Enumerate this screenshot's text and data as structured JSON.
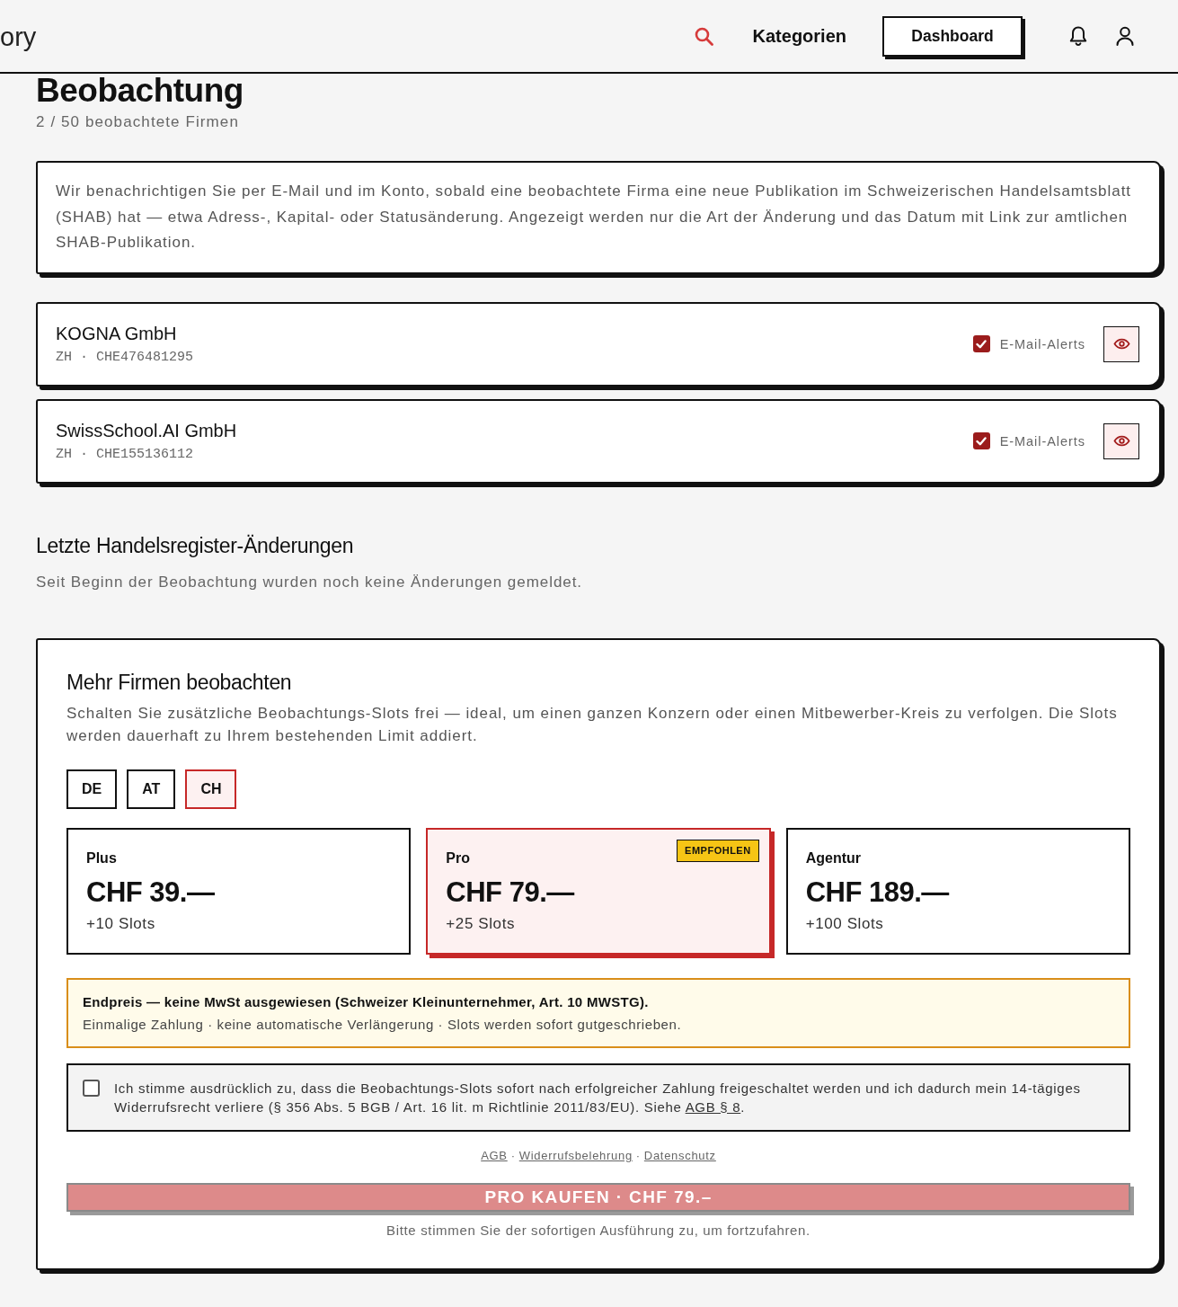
{
  "header": {
    "logo": "ory",
    "nav_link": "Kategorien",
    "dashboard_button": "Dashboard"
  },
  "page": {
    "title": "Beobachtung",
    "subtitle": "2 / 50 beobachtete Firmen"
  },
  "info": "Wir benachrichtigen Sie per E-Mail und im Konto, sobald eine beobachtete Firma eine neue Publikation im Schweizerischen Handelsamtsblatt (SHAB) hat — etwa Adress-, Kapital- oder Statusänderung. Angezeigt werden nur die Art der Änderung und das Datum mit Link zur amtlichen SHAB-Publikation.",
  "companies": [
    {
      "name": "KOGNA GmbH",
      "meta": "ZH · CHE476481295",
      "alert_label": "E-Mail-Alerts",
      "alerts": true
    },
    {
      "name": "SwissSchool.AI GmbH",
      "meta": "ZH · CHE155136112",
      "alert_label": "E-Mail-Alerts",
      "alerts": true
    }
  ],
  "changes": {
    "title": "Letzte Handelsregister-Änderungen",
    "empty_text": "Seit Beginn der Beobachtung wurden noch keine Änderungen gemeldet."
  },
  "upgrade": {
    "title": "Mehr Firmen beobachten",
    "description": "Schalten Sie zusätzliche Beobachtungs-Slots frei — ideal, um einen ganzen Konzern oder einen Mitbewerber-Kreis zu verfolgen. Die Slots werden dauerhaft zu Ihrem bestehenden Limit addiert.",
    "countries": [
      {
        "label": "DE",
        "selected": false
      },
      {
        "label": "AT",
        "selected": false
      },
      {
        "label": "CH",
        "selected": true
      }
    ],
    "plans": [
      {
        "name": "Plus",
        "price": "CHF 39.—",
        "slots": "+10 Slots",
        "selected": false
      },
      {
        "name": "Pro",
        "price": "CHF 79.—",
        "slots": "+25 Slots",
        "badge": "EMPFOHLEN",
        "selected": true
      },
      {
        "name": "Agentur",
        "price": "CHF 189.—",
        "slots": "+100 Slots",
        "selected": false
      }
    ],
    "notice": {
      "title": "Endpreis — keine MwSt ausgewiesen (Schweizer Kleinunternehmer, Art. 10 MWSTG).",
      "text": "Einmalige Zahlung · keine automatische Verlängerung · Slots werden sofort gutgeschrieben."
    },
    "consent": {
      "checked": false,
      "text": "Ich stimme ausdrücklich zu, dass die Beobachtungs-Slots sofort nach erfolgreicher Zahlung freigeschaltet werden und ich dadurch mein 14-tägiges Widerrufsrecht verliere (§ 356 Abs. 5 BGB / Art. 16 lit. m Richtlinie 2011/83/EU). Siehe ",
      "link": "AGB § 8",
      "suffix": "."
    },
    "legal_links": [
      "AGB",
      "Widerrufsbelehrung",
      "Datenschutz"
    ],
    "legal_separator": "·",
    "buy_button": {
      "label": "PRO KAUFEN · CHF 79.–",
      "disabled": true
    },
    "hint": "Bitte stimmen Sie der sofortigen Ausführung zu, um fortzufahren."
  }
}
